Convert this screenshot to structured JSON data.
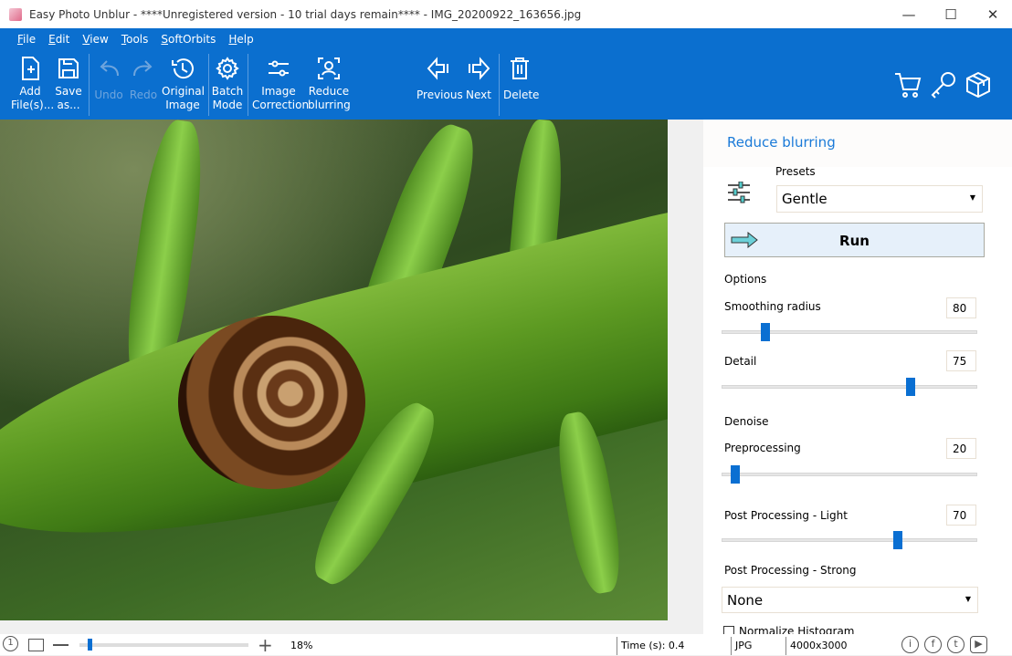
{
  "window": {
    "title": "Easy Photo Unblur - ****Unregistered version - 10 trial days remain**** - IMG_20200922_163656.jpg",
    "minimize": "—",
    "maximize": "☐",
    "close": "✕"
  },
  "menu": [
    "File",
    "Edit",
    "View",
    "Tools",
    "SoftOrbits",
    "Help"
  ],
  "toolbar": {
    "add": [
      "Add",
      "File(s)..."
    ],
    "save": [
      "Save",
      "as..."
    ],
    "undo": "Undo",
    "redo": "Redo",
    "original": [
      "Original",
      "Image"
    ],
    "batch": [
      "Batch",
      "Mode"
    ],
    "correction": [
      "Image",
      "Correction"
    ],
    "reduce": [
      "Reduce",
      "blurring"
    ],
    "previous": "Previous",
    "next": "Next",
    "delete": "Delete"
  },
  "panel": {
    "title": "Reduce blurring",
    "presets_label": "Presets",
    "preset_value": "Gentle",
    "run": "Run",
    "options_label": "Options",
    "denoise_label": "Denoise",
    "sliders": [
      {
        "label": "Smoothing radius",
        "value": "80",
        "level": 0.17
      },
      {
        "label": "Detail",
        "value": "75",
        "level": 0.74
      },
      {
        "label": "Preprocessing",
        "value": "20",
        "level": 0.05
      },
      {
        "label": "Post Processing - Light",
        "value": "70",
        "level": 0.69
      }
    ],
    "post_strong_label": "Post Processing - Strong",
    "post_strong_value": "None",
    "normalize_label": "Normalize Histogram",
    "normalize_checked": false
  },
  "status": {
    "zoom": "18%",
    "zoom_level": 0.05,
    "time": "Time (s): 0.4",
    "format": "JPG",
    "dimensions": "4000x3000"
  },
  "colors": {
    "accent": "#0b6fcf",
    "panel_title": "#1a7ad8"
  }
}
